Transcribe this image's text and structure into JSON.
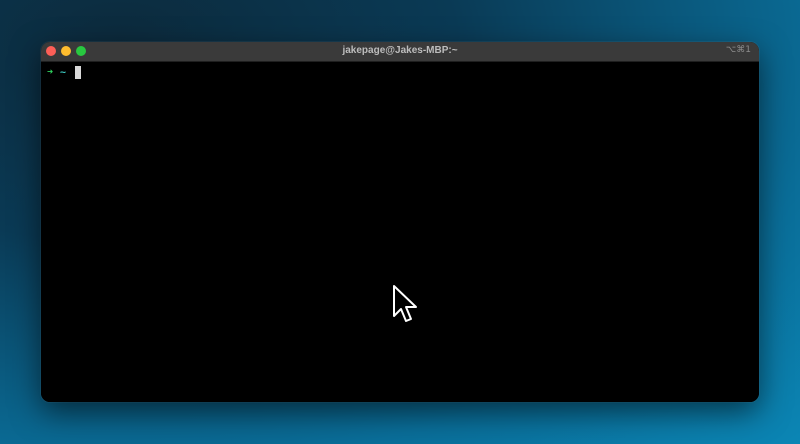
{
  "window": {
    "title": "jakepage@Jakes-MBP:~",
    "shortcut": "⌥⌘1"
  },
  "terminal": {
    "prompt_symbol": "➜",
    "prompt_dir": "~"
  },
  "colors": {
    "close": "#fe5f57",
    "minimize": "#febc2e",
    "maximize": "#28c840",
    "prompt_arrow": "#2fd35e",
    "prompt_dir": "#3fd0c8"
  }
}
